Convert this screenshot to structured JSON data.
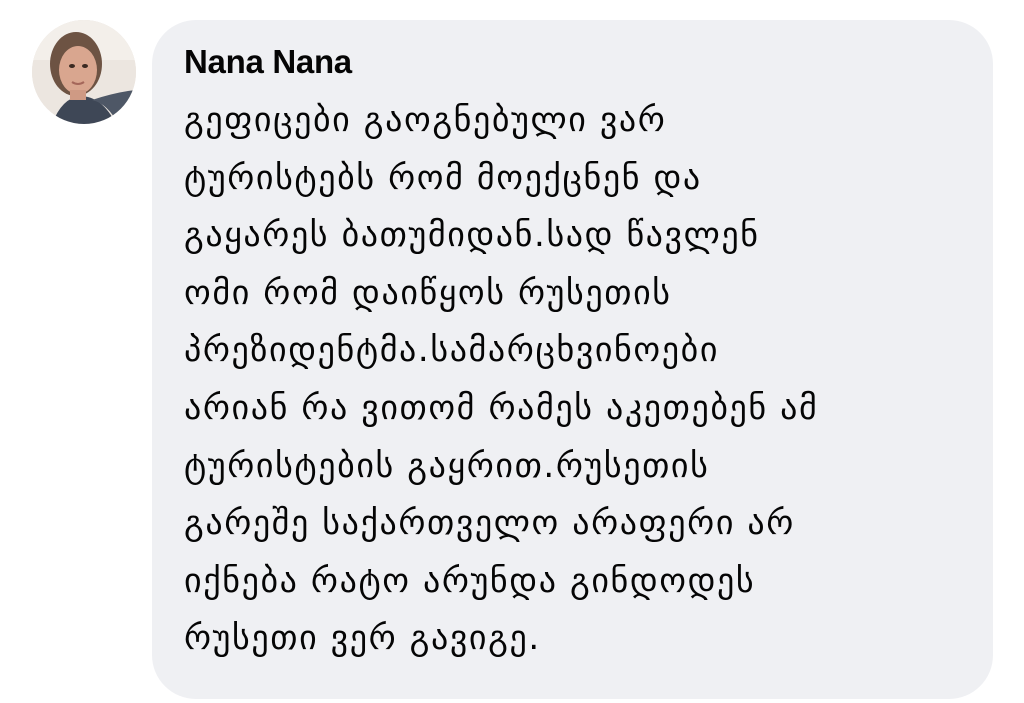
{
  "comment": {
    "author": "Nana Nana",
    "avatar_icon": "profile-photo",
    "bubble_color": "#eff0f3",
    "text_lines": [
      "გეფიცები გაოგნებული ვარ",
      "ტურისტებს რომ მოექცნენ და",
      "გაყარეს ბათუმიდან.სად წავლენ",
      "ომი რომ დაიწყოს რუსეთის",
      "პრეზიდენტმა.სამარცხვინოები",
      "არიან რა ვითომ რამეს აკეთებენ ამ",
      "ტურისტების გაყრით.რუსეთის",
      "გარეშე საქართველო არაფერი არ",
      "იქნება რატო არუნდა გინდოდეს",
      "რუსეთი ვერ გავიგე."
    ]
  }
}
